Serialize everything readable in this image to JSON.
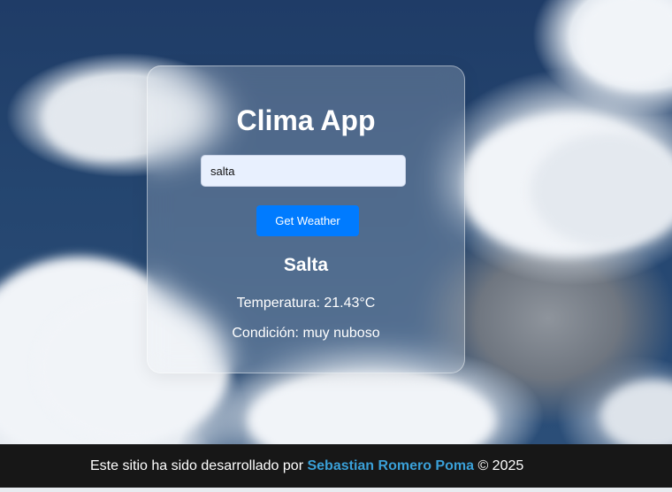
{
  "app": {
    "title": "Clima App"
  },
  "search": {
    "value": "salta",
    "button_label": "Get Weather"
  },
  "weather": {
    "city": "Salta",
    "temperature_label": "Temperatura:",
    "temperature_value": "21.43°C",
    "condition_label": "Condición:",
    "condition_value": "muy nuboso"
  },
  "footer": {
    "prefix": "Este sitio ha sido desarrollado por",
    "author": "Sebastian Romero Poma",
    "suffix": "© 2025"
  },
  "colors": {
    "button": "#007bff",
    "author_link": "#3aa0d8",
    "footer_bg": "#171717"
  }
}
